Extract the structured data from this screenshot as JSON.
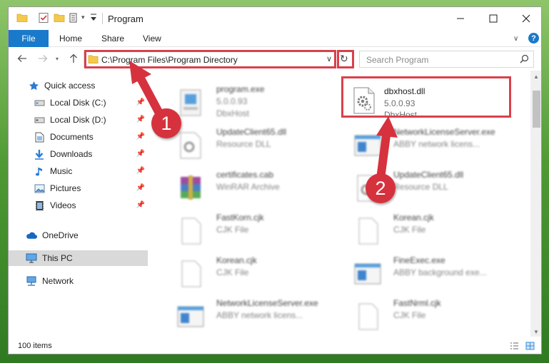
{
  "window": {
    "title": "Program",
    "controls": {
      "minimize": "minimize",
      "maximize": "maximize",
      "close": "close"
    }
  },
  "ribbon": {
    "tabs": [
      "File",
      "Home",
      "Share",
      "View"
    ]
  },
  "address": {
    "path": "C:\\Program Files\\Program Directory",
    "search_placeholder": "Search Program"
  },
  "nav": {
    "items": [
      {
        "label": "Quick access",
        "icon": "star-icon"
      },
      {
        "label": "Local Disk (C:)",
        "icon": "drive-icon",
        "pinned": true
      },
      {
        "label": "Local Disk (D:)",
        "icon": "drive-icon",
        "pinned": true
      },
      {
        "label": "Documents",
        "icon": "documents-icon",
        "pinned": true
      },
      {
        "label": "Downloads",
        "icon": "downloads-icon",
        "pinned": true
      },
      {
        "label": "Music",
        "icon": "music-icon",
        "pinned": true
      },
      {
        "label": "Pictures",
        "icon": "pictures-icon",
        "pinned": true
      },
      {
        "label": "Videos",
        "icon": "videos-icon",
        "pinned": true
      },
      {
        "label": "OneDrive",
        "icon": "cloud-icon"
      },
      {
        "label": "This PC",
        "icon": "computer-icon",
        "selected": true
      },
      {
        "label": "Network",
        "icon": "network-icon"
      }
    ]
  },
  "files": [
    {
      "name": "program.exe",
      "line2": "5.0.0.93",
      "line3": "DbxHost",
      "icon": "exe-icon"
    },
    {
      "name": "dbxhost.dll",
      "line2": "5.0.0.93",
      "line3": "DbxHost",
      "icon": "gear-file-icon"
    },
    {
      "name": "UpdateClient65.dll",
      "line2": "Resource DLL",
      "line3": "",
      "icon": "gear-file-icon"
    },
    {
      "name": "NetworkLicenseServer.exe",
      "line2": "ABBY network licens...",
      "line3": "",
      "icon": "window-icon"
    },
    {
      "name": "certificates.cab",
      "line2": "WinRAR Archive",
      "line3": "",
      "icon": "archive-icon"
    },
    {
      "name": "UpdateClient65.dll",
      "line2": "Resource DLL",
      "line3": "",
      "icon": "gear-file-icon"
    },
    {
      "name": "FastKorn.cjk",
      "line2": "CJK File",
      "line3": "",
      "icon": "blank-file-icon"
    },
    {
      "name": "Korean.cjk",
      "line2": "CJK File",
      "line3": "",
      "icon": "blank-file-icon"
    },
    {
      "name": "Korean.cjk",
      "line2": "CJK File",
      "line3": "",
      "icon": "blank-file-icon"
    },
    {
      "name": "FineExec.exe",
      "line2": "ABBY background exe...",
      "line3": "",
      "icon": "window-icon"
    },
    {
      "name": "NetworkLicenseServer.exe",
      "line2": "ABBY network licens...",
      "line3": "",
      "icon": "window-icon"
    },
    {
      "name": "FastNrml.cjk",
      "line2": "CJK File",
      "line3": "",
      "icon": "blank-file-icon"
    }
  ],
  "status": {
    "count": "100 items"
  },
  "annotations": {
    "step1": "1",
    "step2": "2",
    "color": "#d6323e"
  }
}
